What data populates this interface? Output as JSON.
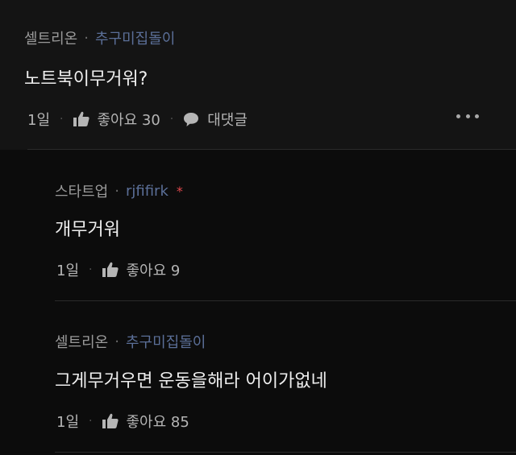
{
  "comments": [
    {
      "company": "셀트리온",
      "nickname": "추구미집돌이",
      "text": "노트북이무거워?",
      "time": "1일",
      "like_label": "좋아요 30",
      "reply_label": "대댓글"
    }
  ],
  "replies": [
    {
      "company": "스타트업",
      "nickname": "rjfifirk",
      "author_mark": "*",
      "text": "개무거워",
      "time": "1일",
      "like_label": "좋아요 9"
    },
    {
      "company": "셀트리온",
      "nickname": "추구미집돌이",
      "text": "그게무거우면 운동을해라 어이가없네",
      "time": "1일",
      "like_label": "좋아요 85"
    }
  ],
  "ui": {
    "separator": "·",
    "meta_separator": "·"
  },
  "colors": {
    "background": "#0c0c0c",
    "main_comment_bg": "#141414",
    "nickname": "#5b6f98",
    "author_mark": "#e0484d",
    "divider": "#2a2a2a"
  },
  "icons": {
    "like": "thumbs-up-icon",
    "reply": "speech-bubble-icon",
    "more": "more-dots-icon"
  }
}
